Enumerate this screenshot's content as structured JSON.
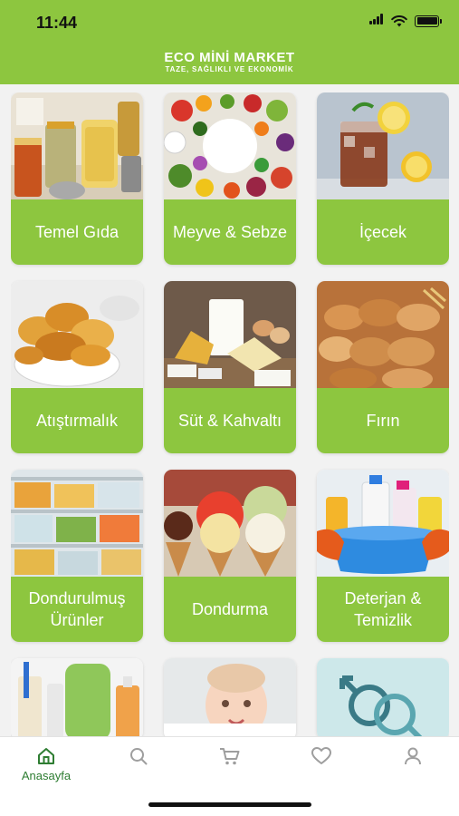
{
  "status_bar": {
    "time": "11:44"
  },
  "brand": {
    "title": "ECO MİNİ MARKET",
    "subtitle": "TAZE, SAĞLIKLI VE EKONOMİK"
  },
  "categories": [
    {
      "label": "Temel Gıda"
    },
    {
      "label": "Meyve & Sebze"
    },
    {
      "label": "İçecek"
    },
    {
      "label": "Atıştırmalık"
    },
    {
      "label": "Süt & Kahvaltı"
    },
    {
      "label": "Fırın"
    },
    {
      "label": "Dondurulmuş Ürünler"
    },
    {
      "label": "Dondurma"
    },
    {
      "label": "Deterjan & Temizlik"
    }
  ],
  "tabbar": {
    "home_label": "Anasayfa",
    "active_color": "#2e7d32",
    "inactive_color": "#9e9e9e"
  },
  "colors": {
    "brand_green": "#8dc63f",
    "background": "#f2f2f2"
  }
}
